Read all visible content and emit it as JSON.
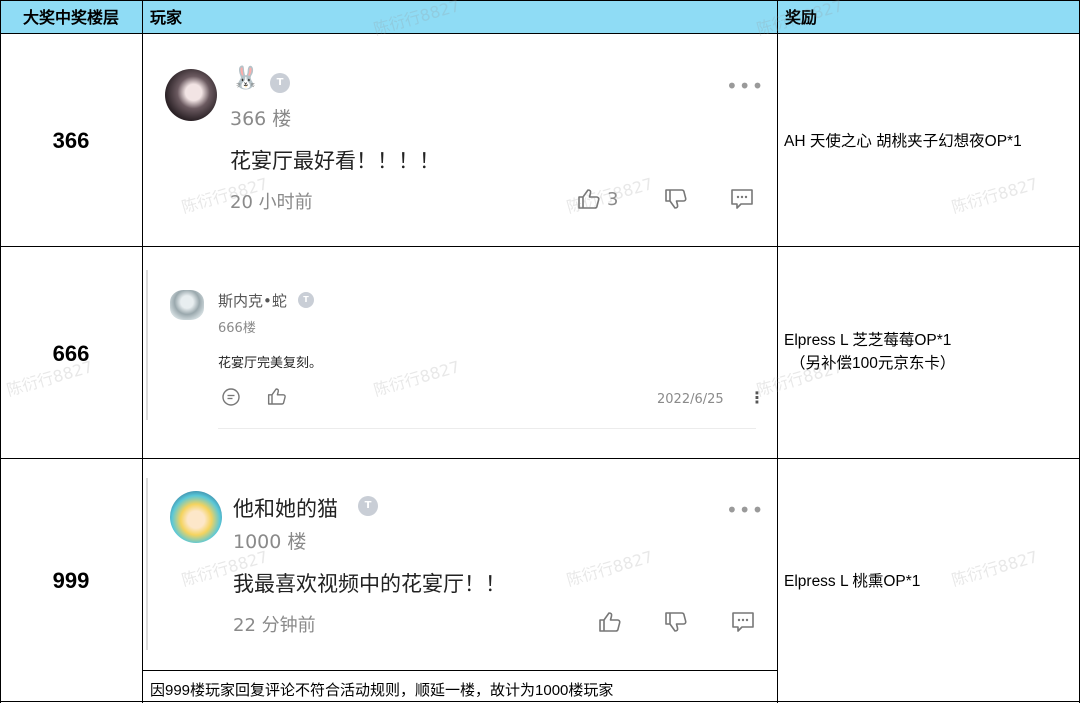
{
  "header": {
    "col1": "大奖中奖楼层",
    "col2": "玩家",
    "col3": "奖励"
  },
  "rows": [
    {
      "floor": "366",
      "user_emoji": "🐰",
      "badge": "T",
      "floor_label": "366 楼",
      "comment": "花宴厅最好看！！！！",
      "time": "20 小时前",
      "likes": "3",
      "reward": "AH 天使之心 胡桃夹子幻想夜OP*1"
    },
    {
      "floor": "666",
      "user_name": "斯内克•蛇",
      "badge": "T",
      "floor_label": "666楼",
      "comment": "花宴厅完美复刻。",
      "date": "2022/6/25",
      "reward_line1": "Elpress L 芝芝莓莓OP*1",
      "reward_line2": "（另补偿100元京东卡）"
    },
    {
      "floor": "999",
      "user_name": "他和她的猫",
      "badge": "T",
      "floor_label": "1000 楼",
      "comment": "我最喜欢视频中的花宴厅！！",
      "time": "22 分钟前",
      "reward": "Elpress L 桃熏OP*1"
    }
  ],
  "note": "因999楼玩家回复评论不符合活动规则，顺延一楼，故计为1000楼玩家",
  "watermark": "陈衍行8827",
  "colors": {
    "header_bg": "#8fdcf5",
    "text_gray": "#8a8a8a",
    "badge": "#c9ced6"
  }
}
